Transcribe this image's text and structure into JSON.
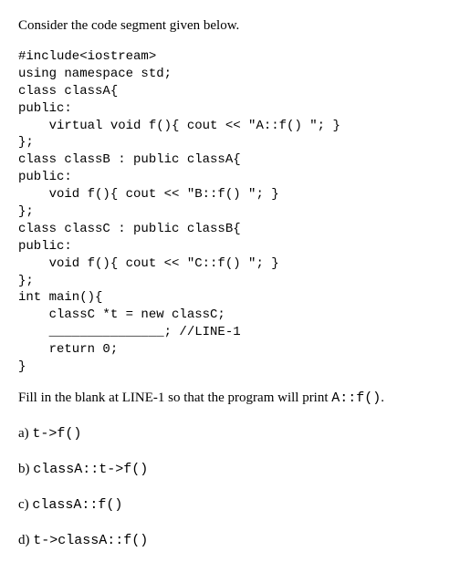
{
  "intro": "Consider the code segment given below.",
  "code": "#include<iostream>\nusing namespace std;\nclass classA{\npublic:\n    virtual void f(){ cout << \"A::f() \"; }\n};\nclass classB : public classA{\npublic:\n    void f(){ cout << \"B::f() \"; }\n};\nclass classC : public classB{\npublic:\n    void f(){ cout << \"C::f() \"; }\n};\nint main(){\n    classC *t = new classC;\n    _______________; //LINE-1\n    return 0;\n}",
  "question_prefix": "Fill in the blank at LINE-1 so that the program will print ",
  "question_code": "A::f()",
  "question_suffix": ".",
  "options": [
    {
      "label": "a) ",
      "code": "t->f()"
    },
    {
      "label": "b) ",
      "code": "classA::t->f()"
    },
    {
      "label": "c) ",
      "code": "classA::f()"
    },
    {
      "label": "d) ",
      "code": "t->classA::f()"
    }
  ]
}
